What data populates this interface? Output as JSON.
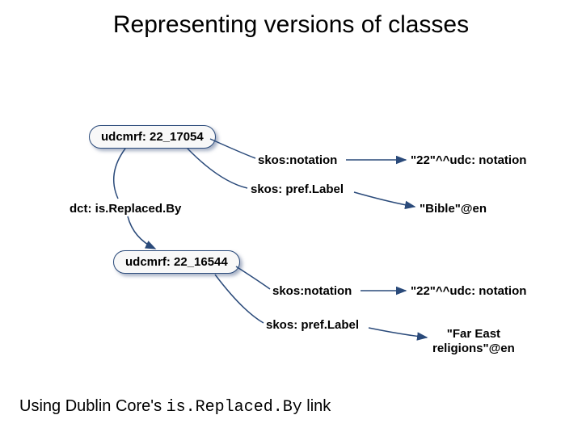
{
  "title": "Representing versions of classes",
  "nodes": {
    "node1": "udcmrf: 22_17054",
    "node2": "udcmrf: 22_16544"
  },
  "edges": {
    "notation1": "skos:notation",
    "prefLabel1": "skos: pref.Label",
    "isReplacedBy": "dct: is.Replaced.By",
    "notation2": "skos:notation",
    "prefLabel2": "skos: pref.Label"
  },
  "literals": {
    "notationVal1": "\"22\"^^udc: notation",
    "prefLabelVal1": "\"Bible\"@en",
    "notationVal2": "\"22\"^^udc: notation",
    "prefLabelVal2_l1": "\"Far East",
    "prefLabelVal2_l2": "religions\"@en"
  },
  "footer": {
    "before": "Using Dublin Core's ",
    "code": "is.Replaced.By",
    "after": " link"
  }
}
